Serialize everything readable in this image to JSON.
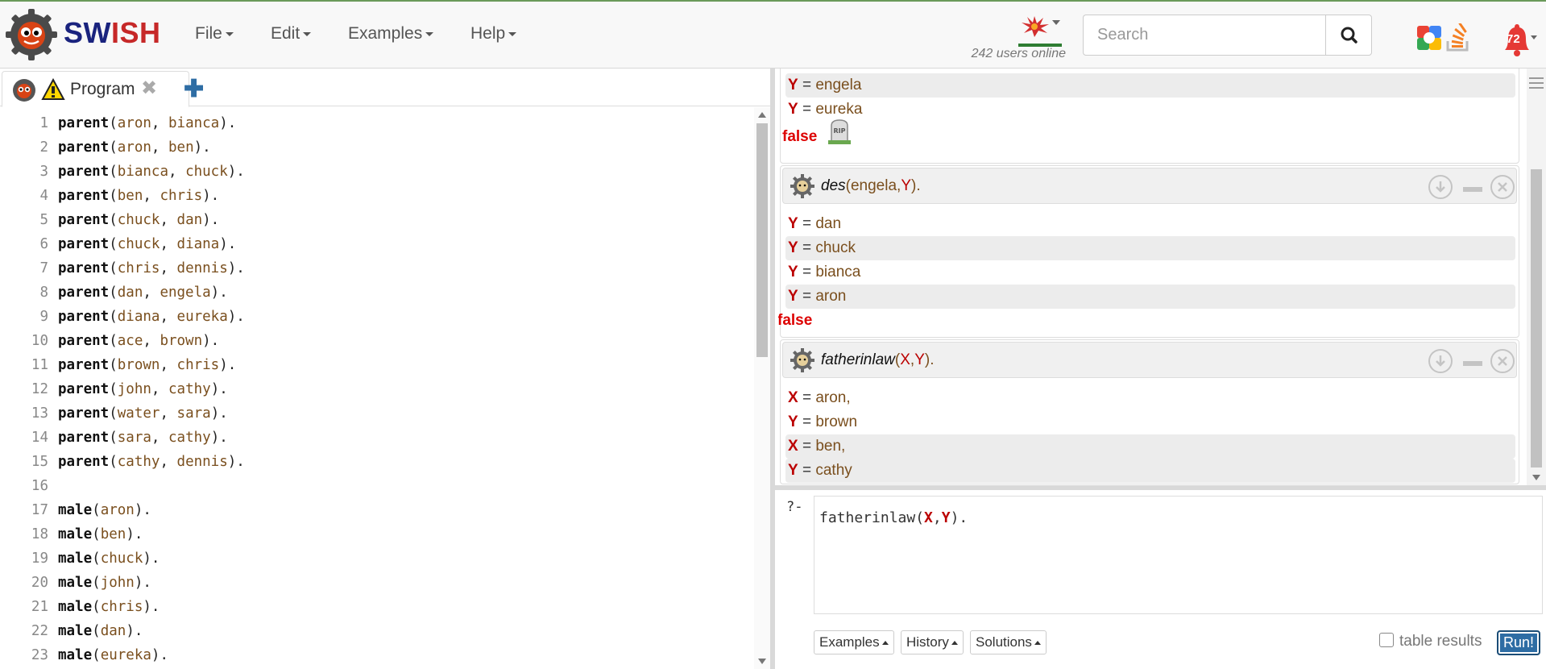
{
  "brand": {
    "part1": "SW",
    "part2": "I",
    "part3": "SH"
  },
  "menu": [
    "File",
    "Edit",
    "Examples",
    "Help"
  ],
  "users_online": "242 users online",
  "search": {
    "placeholder": "Search"
  },
  "notifications": {
    "count": "72"
  },
  "tab": {
    "label": "Program",
    "close": "✖",
    "add": "✚"
  },
  "code_lines": [
    {
      "n": "1",
      "pred": "parent",
      "args": [
        "aron",
        "bianca"
      ]
    },
    {
      "n": "2",
      "pred": "parent",
      "args": [
        "aron",
        "ben"
      ]
    },
    {
      "n": "3",
      "pred": "parent",
      "args": [
        "bianca",
        "chuck"
      ]
    },
    {
      "n": "4",
      "pred": "parent",
      "args": [
        "ben",
        "chris"
      ]
    },
    {
      "n": "5",
      "pred": "parent",
      "args": [
        "chuck",
        "dan"
      ]
    },
    {
      "n": "6",
      "pred": "parent",
      "args": [
        "chuck",
        "diana"
      ]
    },
    {
      "n": "7",
      "pred": "parent",
      "args": [
        "chris",
        "dennis"
      ]
    },
    {
      "n": "8",
      "pred": "parent",
      "args": [
        "dan",
        "engela"
      ]
    },
    {
      "n": "9",
      "pred": "parent",
      "args": [
        "diana",
        "eureka"
      ]
    },
    {
      "n": "10",
      "pred": "parent",
      "args": [
        "ace",
        "brown"
      ]
    },
    {
      "n": "11",
      "pred": "parent",
      "args": [
        "brown",
        "chris"
      ]
    },
    {
      "n": "12",
      "pred": "parent",
      "args": [
        "john",
        "cathy"
      ]
    },
    {
      "n": "13",
      "pred": "parent",
      "args": [
        "water",
        "sara"
      ]
    },
    {
      "n": "14",
      "pred": "parent",
      "args": [
        "sara",
        "cathy"
      ]
    },
    {
      "n": "15",
      "pred": "parent",
      "args": [
        "cathy",
        "dennis"
      ]
    },
    {
      "n": "16",
      "pred": "",
      "args": []
    },
    {
      "n": "17",
      "pred": "male",
      "args": [
        "aron"
      ]
    },
    {
      "n": "18",
      "pred": "male",
      "args": [
        "ben"
      ]
    },
    {
      "n": "19",
      "pred": "male",
      "args": [
        "chuck"
      ]
    },
    {
      "n": "20",
      "pred": "male",
      "args": [
        "john"
      ]
    },
    {
      "n": "21",
      "pred": "male",
      "args": [
        "chris"
      ]
    },
    {
      "n": "22",
      "pred": "male",
      "args": [
        "dan"
      ]
    },
    {
      "n": "23",
      "pred": "male",
      "args": [
        "eureka"
      ]
    }
  ],
  "answers": {
    "top_rows": [
      {
        "var": "Y",
        "val": "engela"
      },
      {
        "var": "Y",
        "val": "eureka"
      }
    ],
    "top_false": "false",
    "rip_label": "RIP",
    "runner1": {
      "fn": "des",
      "args_pre": "(engela,",
      "var": "Y",
      "args_post": ").",
      "rows": [
        {
          "var": "Y",
          "val": "dan"
        },
        {
          "var": "Y",
          "val": "chuck"
        },
        {
          "var": "Y",
          "val": "bianca"
        },
        {
          "var": "Y",
          "val": "aron"
        }
      ],
      "false": "false"
    },
    "runner2": {
      "fn": "fatherinlaw",
      "open": "(",
      "var1": "X",
      "comma": ",",
      "var2": "Y",
      "close": ").",
      "rows": [
        {
          "var": "X",
          "val": "aron,"
        },
        {
          "var": "Y",
          "val": "brown"
        },
        {
          "var": "X",
          "val": "ben,"
        },
        {
          "var": "Y",
          "val": "cathy"
        }
      ]
    }
  },
  "query": {
    "prompt": "?-",
    "pre": "fatherinlaw(",
    "var1": "X",
    "comma": ",",
    "var2": "Y",
    "post": ")."
  },
  "buttons": {
    "examples": "Examples",
    "history": "History",
    "solutions": "Solutions",
    "table_results": "table results",
    "run": "Run!"
  },
  "colors": {
    "brand_blue": "#1a237e",
    "brand_red": "#c62828",
    "variable": "#bb0000",
    "atom": "#7a4f1e",
    "false": "#dd0000",
    "run_button": "#2e6da4"
  }
}
